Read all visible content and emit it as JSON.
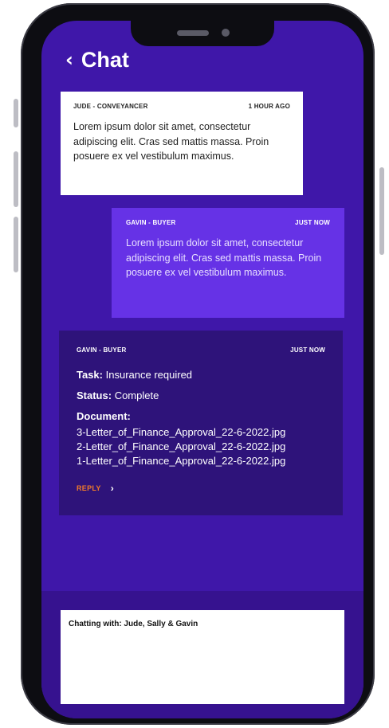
{
  "header": {
    "back_icon": "‹",
    "title": "Chat"
  },
  "messages": [
    {
      "sender": "JUDE - CONVEYANCER",
      "time": "1 HOUR AGO",
      "body": "Lorem ipsum dolor sit amet, consectetur adipiscing elit. Cras sed mattis massa. Proin posuere ex vel vestibulum maximus."
    },
    {
      "sender": "GAVIN - BUYER",
      "time": "JUST NOW",
      "body": "Lorem ipsum dolor sit amet, consectetur adipiscing elit. Cras sed mattis massa. Proin posuere ex vel vestibulum maximus."
    }
  ],
  "task_card": {
    "sender": "GAVIN - BUYER",
    "time": "JUST NOW",
    "task_label": "Task:",
    "task_value": "Insurance required",
    "status_label": "Status:",
    "status_value": "Complete",
    "document_label": "Document:",
    "documents": [
      "3-Letter_of_Finance_Approval_22-6-2022.jpg",
      "2-Letter_of_Finance_Approval_22-6-2022.jpg",
      "1-Letter_of_Finance_Approval_22-6-2022.jpg"
    ],
    "reply_label": "REPLY",
    "reply_chevron": "›"
  },
  "composer": {
    "label": "Chatting with: Jude, Sally & Gavin"
  },
  "colors": {
    "screen_bg": "#3f17a9",
    "outgoing_bubble": "#6632e6",
    "task_card_bg": "#2e137a",
    "reply_accent": "#f07a2a"
  }
}
